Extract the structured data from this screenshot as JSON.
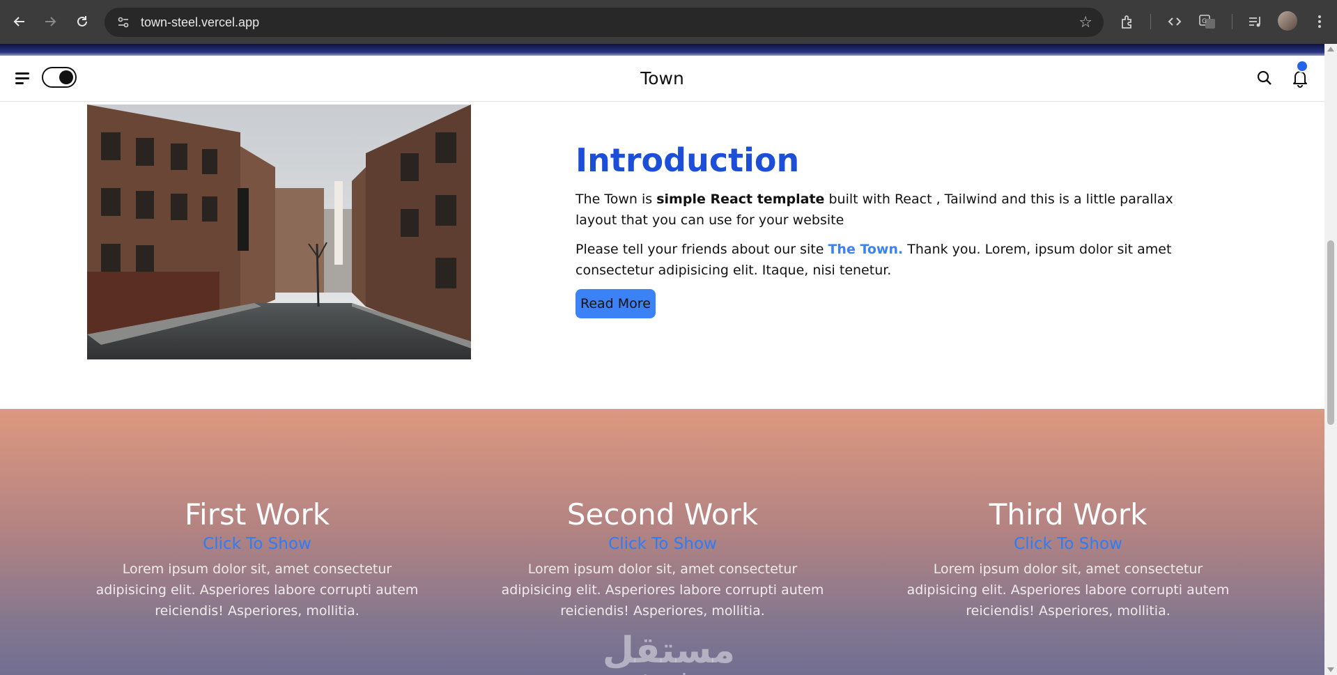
{
  "browser": {
    "url": "town-steel.vercel.app",
    "icons": [
      "back-icon",
      "forward-icon",
      "reload-icon",
      "site-settings-icon",
      "bookmark-star-icon",
      "extensions-icon",
      "devtools-icon",
      "translate-icon",
      "media-icon",
      "profile-avatar",
      "more-icon"
    ]
  },
  "appbar": {
    "brand": "Town",
    "icons": [
      "menu-icon",
      "theme-toggle",
      "search-icon",
      "bell-icon"
    ],
    "accent": "#2563eb"
  },
  "intro": {
    "title": "Introduction",
    "p1_pre": "The Town is ",
    "p1_bold": "simple React template",
    "p1_post": " built with React , Tailwind and this is a little parallax layout that you can use for your website",
    "p2_pre": "Please tell your friends about our site ",
    "p2_link": "The Town.",
    "p2_post": " Thank you. Lorem, ipsum dolor sit amet consectetur adipisicing elit. Itaque, nisi tenetur.",
    "button": "Read More",
    "title_color": "#1d4ed8"
  },
  "works": [
    {
      "title": "First Work",
      "link": "Click To Show",
      "text": "Lorem ipsum dolor sit, amet consectetur adipisicing elit. Asperiores labore corrupti autem reiciendis! Asperiores, mollitia."
    },
    {
      "title": "Second Work",
      "link": "Click To Show",
      "text": "Lorem ipsum dolor sit, amet consectetur adipisicing elit. Asperiores labore corrupti autem reiciendis! Asperiores, mollitia."
    },
    {
      "title": "Third Work",
      "link": "Click To Show",
      "text": "Lorem ipsum dolor sit, amet consectetur adipisicing elit. Asperiores labore corrupti autem reiciendis! Asperiores, mollitia."
    }
  ],
  "watermark": {
    "arabic": "مستقل",
    "latin": "mostaql.com"
  }
}
